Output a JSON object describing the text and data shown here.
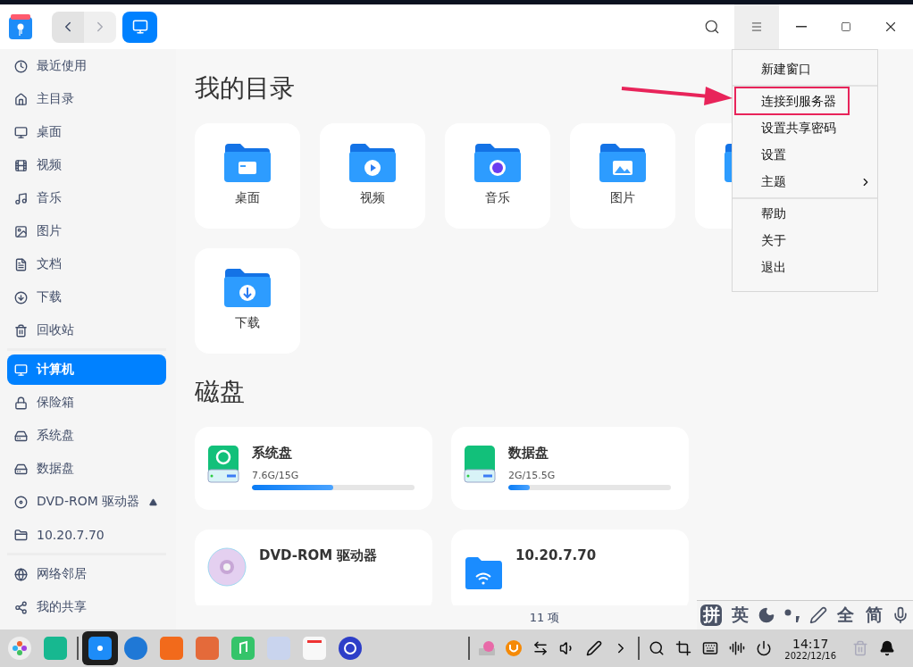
{
  "titlebar": {
    "history": [
      {
        "kind": "back",
        "disabled": false
      },
      {
        "kind": "forward",
        "disabled": true
      }
    ],
    "controls": [
      {
        "kind": "search",
        "selected": false
      },
      {
        "kind": "menu",
        "selected": true
      },
      {
        "kind": "minimize",
        "selected": false
      },
      {
        "kind": "maximize",
        "selected": false
      },
      {
        "kind": "close",
        "selected": false
      }
    ]
  },
  "sidebar": {
    "groups": [
      {
        "items": [
          {
            "kind": "recent",
            "label": "最近使用",
            "selected": false,
            "eject": false
          },
          {
            "kind": "home",
            "label": "主目录",
            "selected": false,
            "eject": false
          },
          {
            "kind": "desktop",
            "label": "桌面",
            "selected": false,
            "eject": false
          },
          {
            "kind": "video",
            "label": "视频",
            "selected": false,
            "eject": false
          },
          {
            "kind": "music",
            "label": "音乐",
            "selected": false,
            "eject": false
          },
          {
            "kind": "picture",
            "label": "图片",
            "selected": false,
            "eject": false
          },
          {
            "kind": "document",
            "label": "文档",
            "selected": false,
            "eject": false
          },
          {
            "kind": "download",
            "label": "下载",
            "selected": false,
            "eject": false
          },
          {
            "kind": "trash",
            "label": "回收站",
            "selected": false,
            "eject": false
          }
        ]
      },
      {
        "items": [
          {
            "kind": "computer",
            "label": "计算机",
            "selected": true,
            "eject": false
          },
          {
            "kind": "vault",
            "label": "保险箱",
            "selected": false,
            "eject": false
          },
          {
            "kind": "disk",
            "label": "系统盘",
            "selected": false,
            "eject": false
          },
          {
            "kind": "disk",
            "label": "数据盘",
            "selected": false,
            "eject": false
          },
          {
            "kind": "disc",
            "label": "DVD-ROM 驱动器",
            "selected": false,
            "eject": true
          },
          {
            "kind": "network-folder",
            "label": "10.20.7.70",
            "selected": false,
            "eject": false
          }
        ]
      },
      {
        "items": [
          {
            "kind": "network",
            "label": "网络邻居",
            "selected": false,
            "eject": false
          },
          {
            "kind": "share",
            "label": "我的共享",
            "selected": false,
            "eject": false
          }
        ]
      }
    ]
  },
  "directories": {
    "title": "我的目录",
    "items": [
      {
        "kind": "desktop",
        "label": "桌面"
      },
      {
        "kind": "video",
        "label": "视频"
      },
      {
        "kind": "music",
        "label": "音乐"
      },
      {
        "kind": "picture",
        "label": "图片"
      },
      {
        "kind": "document"
      },
      {
        "kind": "download",
        "label": "下载"
      }
    ]
  },
  "disks": {
    "title": "磁盘",
    "items": [
      {
        "kind": "system",
        "label": "系统盘",
        "usage": "7.6G/15G",
        "level": 0.5
      },
      {
        "kind": "data",
        "label": "数据盘",
        "usage": "2G/15.5G",
        "level": 0.13
      },
      {
        "kind": "dvd",
        "label": "DVD-ROM 驱动器"
      },
      {
        "kind": "network",
        "label": "10.20.7.70"
      }
    ]
  },
  "status_bar": "11 项",
  "menu": {
    "groups": [
      {
        "items": [
          {
            "label": "新建窗口",
            "submenu": false,
            "annotated": false
          }
        ]
      },
      {
        "items": [
          {
            "label": "连接到服务器",
            "submenu": false,
            "annotated": true
          },
          {
            "label": "设置共享密码",
            "submenu": false,
            "annotated": false
          },
          {
            "label": "设置",
            "submenu": false,
            "annotated": false
          },
          {
            "label": "主题",
            "submenu": true,
            "annotated": false
          }
        ]
      },
      {
        "items": [
          {
            "label": "帮助",
            "submenu": false,
            "annotated": false
          },
          {
            "label": "关于",
            "submenu": false,
            "annotated": false
          },
          {
            "label": "退出",
            "submenu": false,
            "annotated": false
          }
        ]
      }
    ]
  },
  "ime": {
    "items": [
      {
        "kind": "text",
        "label": "拼",
        "selected": true
      },
      {
        "kind": "text",
        "label": "英",
        "selected": false
      },
      {
        "kind": "moon"
      },
      {
        "kind": "punctuation"
      },
      {
        "kind": "pen"
      },
      {
        "kind": "text",
        "label": "全",
        "selected": false
      },
      {
        "kind": "text",
        "label": "简",
        "selected": false
      },
      {
        "kind": "mic"
      }
    ]
  },
  "taskbar": {
    "apps": [
      {
        "kind": "launcher",
        "selected": false
      },
      {
        "kind": "desktop-app",
        "selected": false
      },
      {
        "kind": "separator"
      },
      {
        "kind": "files",
        "selected": true
      },
      {
        "kind": "browser",
        "selected": false
      },
      {
        "kind": "store",
        "selected": false
      },
      {
        "kind": "photos",
        "selected": false
      },
      {
        "kind": "music",
        "selected": false
      },
      {
        "kind": "contacts",
        "selected": false
      },
      {
        "kind": "calendar",
        "selected": false
      },
      {
        "kind": "settings",
        "selected": false
      }
    ],
    "tray": [
      {
        "kind": "separator"
      },
      {
        "kind": "keyboard-layout"
      },
      {
        "kind": "update"
      },
      {
        "kind": "transfer"
      },
      {
        "kind": "volume"
      },
      {
        "kind": "pen"
      },
      {
        "kind": "expand"
      },
      {
        "kind": "separator"
      },
      {
        "kind": "search"
      },
      {
        "kind": "screenshot"
      },
      {
        "kind": "keyboard"
      },
      {
        "kind": "assistant"
      },
      {
        "kind": "power"
      }
    ],
    "clock": {
      "time": "14:17",
      "date": "2022/12/16"
    }
  }
}
